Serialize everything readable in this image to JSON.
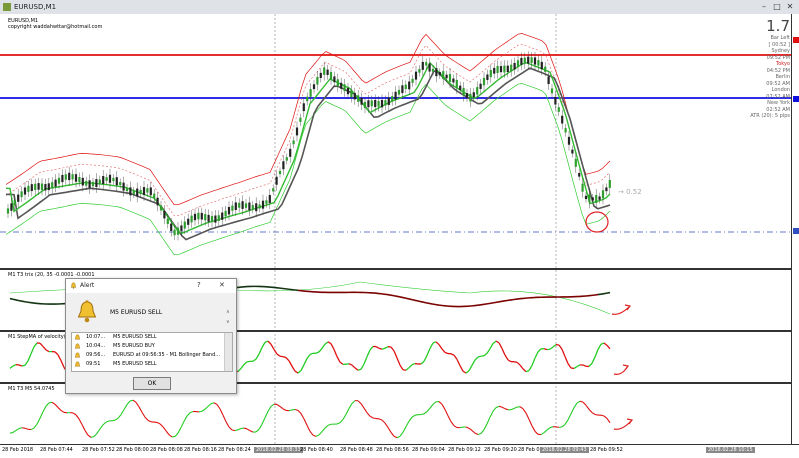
{
  "window": {
    "title": "EURUSD,M1",
    "minimize": "–",
    "maximize": "□",
    "close": "✕"
  },
  "chart_info": {
    "symbol": "EURUSD,M1",
    "copyright": "copyright waddahwttar@hotmail.com"
  },
  "right_panel": {
    "big_value": "1.7",
    "rows": [
      "Bar Left",
      "[ 00:52 ]",
      "Sydney",
      "09:52 PM",
      "Tokyo",
      "04:52 PM",
      "Berlin",
      "09:52 AM",
      "London",
      "07:52 AM",
      "New York",
      "02:52 AM",
      "ATR (20): 5 pips"
    ]
  },
  "price_label": "0.52",
  "subwindows": [
    {
      "label": "M1 T3 trix (20, 35 -0.0001 -0.0001"
    },
    {
      "label": "M1 StepMA of velocity(5"
    },
    {
      "label": "M1 T3 M5 54.0745"
    }
  ],
  "time_axis": [
    "28 Feb 2018",
    "28 Feb 07:44",
    "28 Feb 07:52",
    "28 Feb 08:00",
    "28 Feb 08:08",
    "28 Feb 08:16",
    "28 Feb 08:24",
    "2018.02.28 08:33",
    "28 Feb 08:40",
    "28 Feb 08:48",
    "28 Feb 08:56",
    "28 Feb 09:04",
    "28 Feb 09:12",
    "28 Feb 09:20",
    "28 Feb 09:28",
    "2018.02.28 09:43",
    "28 Feb 09:52",
    "2018.02.28 10:15"
  ],
  "alert": {
    "title": "Alert",
    "help": "?",
    "close": "✕",
    "message": "M5 EURUSD  SELL",
    "rows": [
      {
        "time": "10:07...",
        "text": "M5 EURUSD  SELL"
      },
      {
        "time": "10:04...",
        "text": "M5 EURUSD  BUY"
      },
      {
        "time": "09:56...",
        "text": "EURUSD at 09:56:35 - M1 Bollinger Band..."
      },
      {
        "time": "09:51",
        "text": "M5 EURUSD  SELL"
      }
    ],
    "ok": "OK"
  },
  "colors": {
    "bull": "#2e9e2e",
    "bear": "#222222",
    "red_line": "#e01010",
    "blue_line": "#1010e0",
    "green": "#33cc33"
  }
}
